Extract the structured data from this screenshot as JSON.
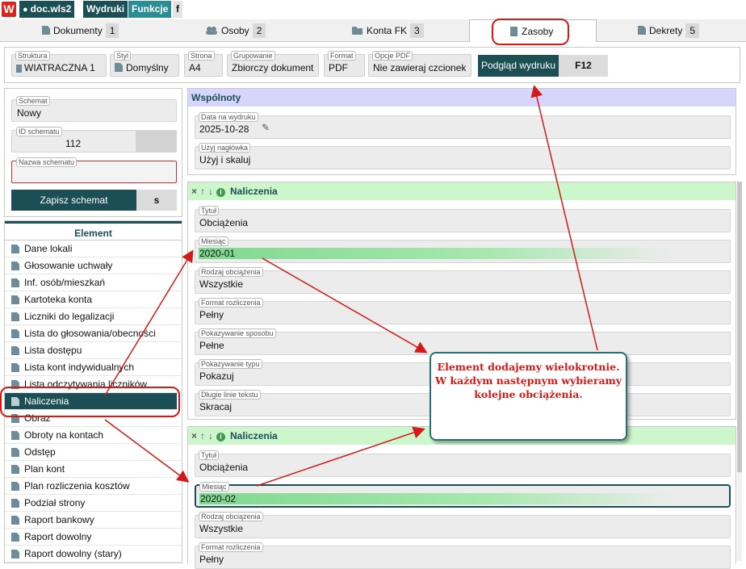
{
  "topbar": {
    "logo": "W",
    "doc": "doc.wls2",
    "wydruki": "Wydruki",
    "funkcje": "Funkcje",
    "f": "f"
  },
  "tabs": [
    {
      "label": "Dokumenty",
      "num": "1",
      "icon": "doc-icon"
    },
    {
      "label": "Osoby",
      "num": "2",
      "icon": "people-icon"
    },
    {
      "label": "Konta FK",
      "num": "3",
      "icon": "folder-icon"
    },
    {
      "label": "Zasoby",
      "num": "",
      "icon": "building-icon"
    },
    {
      "label": "Dekrety",
      "num": "5",
      "icon": "doc-icon"
    }
  ],
  "options": [
    {
      "label": "Struktura",
      "value": "WIATRACZNA 1"
    },
    {
      "label": "Styl",
      "value": "Domyślny"
    },
    {
      "label": "Strona",
      "value": "A4"
    },
    {
      "label": "Grupowanie",
      "value": "Zbiorczy dokument"
    },
    {
      "label": "Format",
      "value": "PDF"
    },
    {
      "label": "Opcje PDF",
      "value": "Nie zawieraj czcionek"
    }
  ],
  "preview": {
    "label": "Podgląd wydruku",
    "shortcut": "F12"
  },
  "schema": {
    "schemat_label": "Schemat",
    "schemat_value": "Nowy",
    "id_label": "ID schematu",
    "id_value": "112",
    "name_label": "Nazwa schematu",
    "name_value": "",
    "save_label": "Zapisz schemat",
    "s_label": "s"
  },
  "elements": {
    "header": "Element",
    "items": [
      "Dane lokali",
      "Głosowanie uchwały",
      "Inf. osób/mieszkań",
      "Kartoteka konta",
      "Liczniki do legalizacji",
      "Lista do głosowania/obecności",
      "Lista dostępu",
      "Lista kont indywidualnych",
      "Lista odczytywania liczników",
      "Naliczenia",
      "Obraz",
      "Obroty na kontach",
      "Odstęp",
      "Plan kont",
      "Plan rozliczenia kosztów",
      "Podział strony",
      "Raport bankowy",
      "Raport dowolny",
      "Raport dowolny (stary)"
    ],
    "selected": "Naliczenia"
  },
  "wspolnoty": {
    "title": "Wspólnoty",
    "date_label": "Data na wydruku",
    "date_value": "2025-10-28",
    "header_label": "Użyj nagłówka",
    "header_value": "Użyj i skaluj"
  },
  "naliczenia1": {
    "title": "Naliczenia",
    "fields": [
      {
        "label": "Tytuł",
        "value": "Obciążenia"
      },
      {
        "label": "Miesiąc",
        "value": "2020-01"
      },
      {
        "label": "Rodzaj obciążenia",
        "value": "Wszystkie"
      },
      {
        "label": "Format rozliczenia",
        "value": "Pełny"
      },
      {
        "label": "Pokazywanie sposobu",
        "value": "Pełne"
      },
      {
        "label": "Pokazywanie typu",
        "value": "Pokazuj"
      },
      {
        "label": "Długie linie tekstu",
        "value": "Skracaj"
      }
    ]
  },
  "naliczenia2": {
    "title": "Naliczenia",
    "fields": [
      {
        "label": "Tytuł",
        "value": "Obciążenia"
      },
      {
        "label": "Miesiąc",
        "value": "2020-02"
      },
      {
        "label": "Rodzaj obciążenia",
        "value": "Wszystkie"
      },
      {
        "label": "Format rozliczenia",
        "value": "Pełny"
      }
    ]
  },
  "callout": {
    "line1": "Element dodajemy wielokrotnie.",
    "line2": "W każdym następnym wybieramy",
    "line3": "kolejne obciążenia."
  },
  "colors": {
    "accent": "#1b4e55",
    "annotation": "#d21b16"
  }
}
